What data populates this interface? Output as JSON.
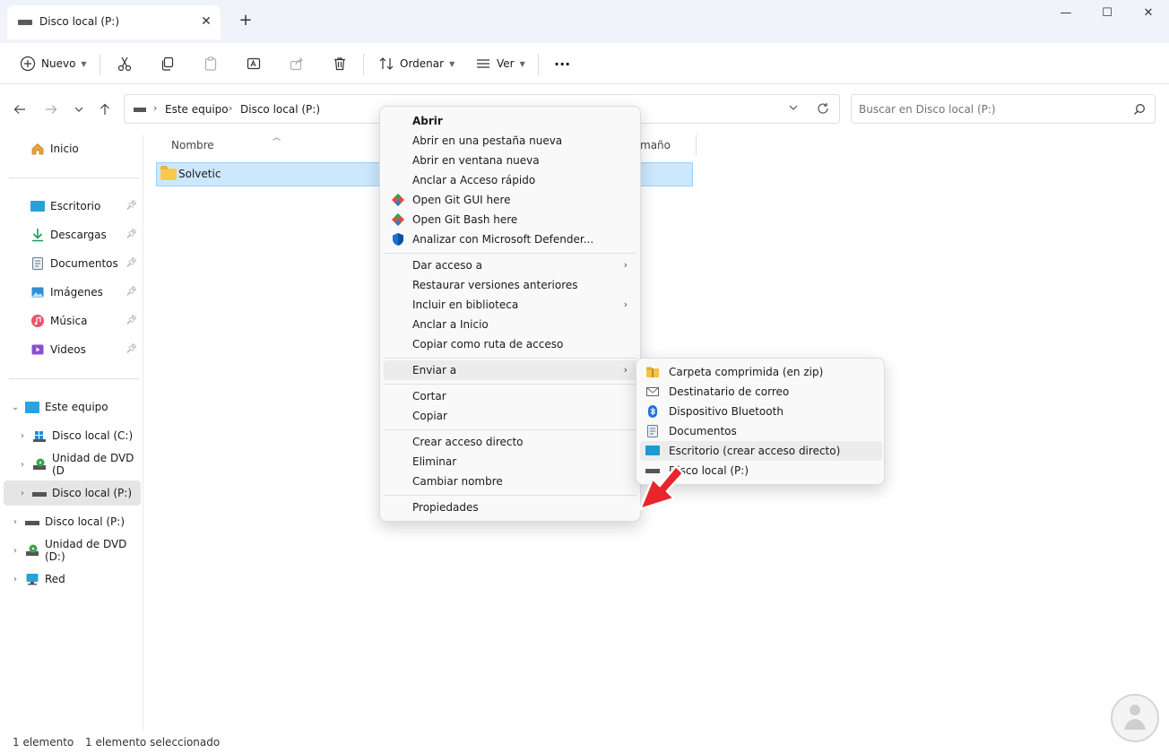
{
  "window": {
    "tab_title": "Disco local (P:)",
    "tab_close": "✕",
    "new_tab": "+",
    "minimize": "—",
    "maximize": "☐",
    "close": "✕"
  },
  "toolbar": {
    "new_label": "Nuevo",
    "sort_label": "Ordenar",
    "view_label": "Ver",
    "more_label": "···"
  },
  "address": {
    "crumbs": [
      "Este equipo",
      "Disco local (P:)"
    ],
    "crumb_sep": "›",
    "search_placeholder": "Buscar en Disco local (P:)"
  },
  "sidebar": {
    "home": "Inicio",
    "quick": [
      {
        "label": "Escritorio"
      },
      {
        "label": "Descargas"
      },
      {
        "label": "Documentos"
      },
      {
        "label": "Imágenes"
      },
      {
        "label": "Música"
      },
      {
        "label": "Videos"
      }
    ],
    "tree": [
      {
        "label": "Este equipo"
      },
      {
        "label": "Disco local (C:)"
      },
      {
        "label": "Unidad de DVD (D"
      },
      {
        "label": "Disco local (P:)"
      },
      {
        "label": "Disco local (P:)"
      },
      {
        "label": "Unidad de DVD (D:)"
      },
      {
        "label": "Red"
      }
    ]
  },
  "content": {
    "col_name": "Nombre",
    "col_size": "maño",
    "files": [
      {
        "name": "Solvetic"
      }
    ]
  },
  "context_menu": {
    "items": [
      "Abrir",
      "Abrir en una pestaña nueva",
      "Abrir en ventana nueva",
      "Anclar a Acceso rápido",
      "Open Git GUI here",
      "Open Git Bash here",
      "Analizar con Microsoft Defender...",
      "Dar acceso a",
      "Restaurar versiones anteriores",
      "Incluir en biblioteca",
      "Anclar a Inicio",
      "Copiar como ruta de acceso",
      "Enviar a",
      "Cortar",
      "Copiar",
      "Crear acceso directo",
      "Eliminar",
      "Cambiar nombre",
      "Propiedades"
    ]
  },
  "send_to_menu": {
    "items": [
      "Carpeta comprimida (en zip)",
      "Destinatario de correo",
      "Dispositivo Bluetooth",
      "Documentos",
      "Escritorio (crear acceso directo)",
      "Disco local (P:)"
    ]
  },
  "status": {
    "count": "1 elemento",
    "selected": "1 elemento seleccionado"
  },
  "colors": {
    "accent": "#0067c0",
    "selection_bg": "#cce8ff",
    "annotation_arrow": "#e8252a"
  }
}
